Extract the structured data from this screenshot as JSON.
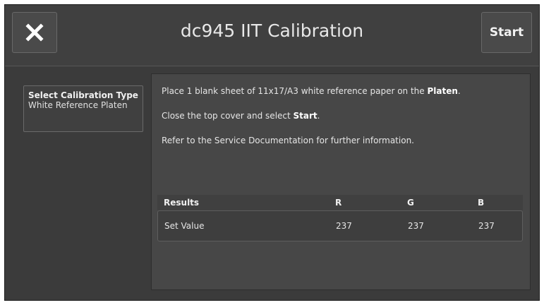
{
  "header": {
    "title": "dc945 IIT Calibration",
    "start_label": "Start"
  },
  "icons": {
    "close": "close-icon"
  },
  "calibration_type": {
    "label": "Select Calibration Type",
    "value": "White Reference Platen"
  },
  "instructions": {
    "line1_prefix": "Place 1 blank sheet of 11x17/A3 white reference paper on the ",
    "line1_bold": "Platen",
    "line1_suffix": ".",
    "line2_prefix": "Close the top cover and select ",
    "line2_bold": "Start",
    "line2_suffix": ".",
    "line3": "Refer to the Service Documentation for further information."
  },
  "results": {
    "columns": [
      "Results",
      "R",
      "G",
      "B"
    ],
    "row": {
      "label": "Set Value",
      "values": [
        "237",
        "237",
        "237"
      ]
    }
  }
}
